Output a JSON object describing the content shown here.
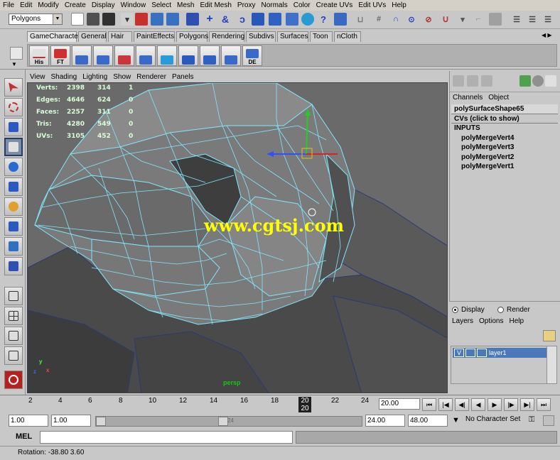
{
  "menubar": {
    "items": [
      "File",
      "Edit",
      "Modify",
      "Create",
      "Display",
      "Window",
      "Select",
      "Mesh",
      "Edit Mesh",
      "Proxy",
      "Normals",
      "Color",
      "Create UVs",
      "Edit UVs",
      "Help"
    ]
  },
  "statusline": {
    "mode": "Polygons"
  },
  "shelf": {
    "tabs": [
      "GameCharacter",
      "General",
      "Hair",
      "PaintEffects",
      "Polygons",
      "Rendering",
      "Subdivs",
      "Surfaces",
      "Toon",
      "nCloth"
    ],
    "active_tab": "GameCharacter",
    "buttons": [
      "His",
      "FT",
      "",
      "",
      "",
      "",
      "",
      "",
      "",
      "",
      "DE"
    ]
  },
  "viewport": {
    "menu": [
      "View",
      "Shading",
      "Lighting",
      "Show",
      "Renderer",
      "Panels"
    ],
    "hud": [
      {
        "label": "Verts:",
        "a": "2398",
        "b": "314",
        "c": "1"
      },
      {
        "label": "Edges:",
        "a": "4646",
        "b": "624",
        "c": "0"
      },
      {
        "label": "Faces:",
        "a": "2257",
        "b": "311",
        "c": "0"
      },
      {
        "label": "Tris:",
        "a": "4280",
        "b": "549",
        "c": "0"
      },
      {
        "label": "UVs:",
        "a": "3105",
        "b": "452",
        "c": "0"
      }
    ],
    "watermark": "www.cgtsj.com",
    "camera": "persp",
    "axis": {
      "y": "y",
      "x": "x",
      "z": "z"
    }
  },
  "channel_box": {
    "menu": [
      "Channels",
      "Object"
    ],
    "node": "polySurfaceShape65",
    "cvs": "CVs (click to show)",
    "inputs_label": "INPUTS",
    "inputs": [
      "polyMergeVert4",
      "polyMergeVert3",
      "polyMergeVert2",
      "polyMergeVert1"
    ]
  },
  "layer_editor": {
    "display": "Display",
    "render": "Render",
    "menu": [
      "Layers",
      "Options",
      "Help"
    ],
    "layer": {
      "visible": "V",
      "name": "layer1"
    }
  },
  "timeslider": {
    "ticks": [
      "2",
      "4",
      "6",
      "8",
      "10",
      "12",
      "14",
      "16",
      "18",
      "20",
      "22",
      "24"
    ],
    "current_frame": "20",
    "frame_field": "20.00"
  },
  "rangeslider": {
    "start": "1.00",
    "start_inner": "1.00",
    "end_inner": "24.00",
    "end": "48.00",
    "bar_label": "24",
    "character_set": "No Character Set"
  },
  "cmdline": {
    "label": "MEL"
  },
  "helpline": {
    "text": "Rotation: -38.80    3.60"
  },
  "colors": {
    "viewport_bg": "#6a6a6a",
    "wire": "#7fe8ff",
    "watermark": "#ffff00",
    "layer_selected": "#4a78b8"
  }
}
